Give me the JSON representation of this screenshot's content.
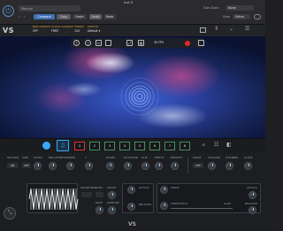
{
  "host": {
    "title": "Inst 9",
    "preset_value": "Manual",
    "buttons": {
      "compare": "Compare",
      "copy": "Copy",
      "paste": "Paste",
      "undo": "Undo",
      "redo": "Redo"
    },
    "side_chain_label": "Side Chain:",
    "side_chain_value": "None",
    "view_label": "View:",
    "view_value": "Editor"
  },
  "plugin": {
    "logo": "VS",
    "header_fields": [
      {
        "label": "BAR LENGTH",
        "value": "OFF"
      },
      {
        "label": "CLOCK SOURCE",
        "value": "FREE"
      },
      {
        "label": "TEMPO",
        "value": "120"
      },
      {
        "label": "SWITCH",
        "value": "Default"
      }
    ]
  },
  "toolbar": {
    "fps": "30 FPS"
  },
  "scenes": [
    "1",
    "2",
    "3",
    "4",
    "5",
    "6",
    "7",
    "8"
  ],
  "controls": {
    "knobs_top": [
      {
        "label": "SHADER",
        "value": "ON"
      },
      {
        "label": "SIZE",
        "value": "OFF"
      },
      {
        "label": "ALPHA",
        "value": ""
      },
      {
        "label": "BRIGHTNESS",
        "value": ""
      },
      {
        "label": "SPEED",
        "value": ""
      },
      {
        "label": "Y",
        "value": ""
      },
      {
        "label": "ZOOM",
        "value": ""
      },
      {
        "label": "ROTATION",
        "value": ""
      },
      {
        "label": "HUE",
        "value": ""
      },
      {
        "label": "DEPTH",
        "value": ""
      },
      {
        "label": "DENSITY",
        "value": ""
      },
      {
        "label": "MODE",
        "value": "OFF"
      },
      {
        "label": "TRIGGER",
        "value": ""
      },
      {
        "label": "CHANNEL",
        "value": ""
      },
      {
        "label": "GLIDE",
        "value": ""
      }
    ],
    "lfo": {
      "waveform_label": "WAVEFORM",
      "sync_label": "SYNC",
      "phase_label": "PHASE",
      "rate_label": "RATE",
      "amount_label": "AMOUNT"
    },
    "env": {
      "attack_label": "ATTACK",
      "release_label": "RELEASE",
      "mode_label": "MODE",
      "threshold_label": "THRESHOLD",
      "gain_label": "GAIN",
      "attack2_label": "ATTACK",
      "release2_label": "RELEASE"
    },
    "footer_logo": "VS"
  }
}
